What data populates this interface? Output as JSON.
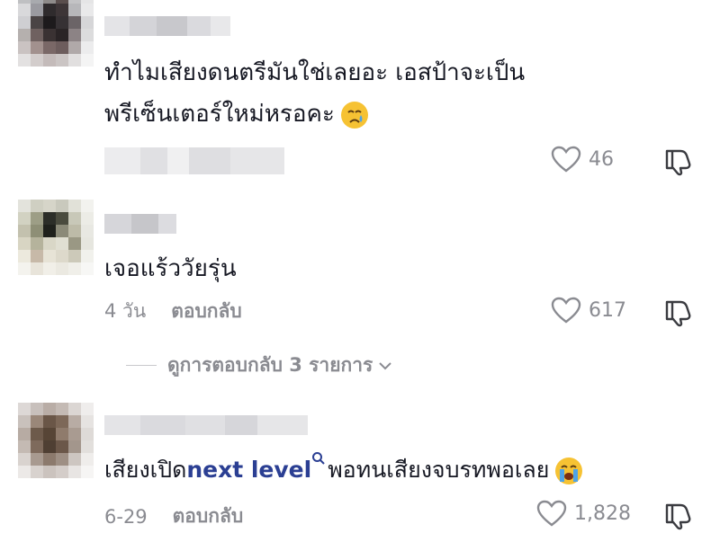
{
  "comments": [
    {
      "text_lines": [
        "ทำไมเสียงดนตรีมันใช่เลยอะ เอสป้าจะเป็น",
        "พรีเซ็นเตอร์ใหม่หรอคะ"
      ],
      "emoji": "crying-face",
      "likes": "46"
    },
    {
      "text": "เจอแร้ววัยรุ่น",
      "time": "4 วัน",
      "reply_label": "ตอบกลับ",
      "likes": "617"
    },
    {
      "text_before": "เสียงเปิด",
      "link": "next level",
      "text_after": "พอทนเสียงจบรทพอเลย",
      "emoji": "loudly-crying-face",
      "time": "6-29",
      "reply_label": "ตอบกลับ",
      "likes": "1,828"
    }
  ],
  "view_replies": "ดูการตอบกลับ 3 รายการ",
  "colors": {
    "text": "#161823",
    "muted": "#8a8b91",
    "link": "#2b3f93"
  }
}
